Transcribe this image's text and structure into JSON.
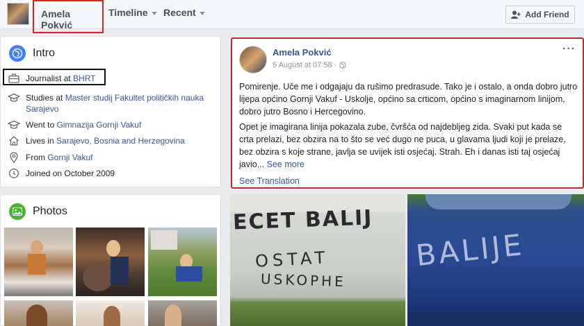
{
  "topbar": {
    "profile_name": "Amela Pokvić",
    "tabs": [
      "Timeline",
      "Recent"
    ],
    "add_friend_label": "Add Friend"
  },
  "intro": {
    "title": "Intro",
    "work_prefix": "Journalist at ",
    "work_org": "BHRT",
    "study_prefix": "Studies at ",
    "study_place": "Master studij Fakultet političkih nauka Sarajevo",
    "went_prefix": "Went to ",
    "went_place": "Gimnazija Gornji Vakuf",
    "lives_prefix": "Lives in ",
    "lives_place": "Sarajevo, Bosnia and Herzegovina",
    "from_prefix": "From ",
    "from_place": "Gornji Vakuf",
    "joined": "Joined on October 2009"
  },
  "photos": {
    "title": "Photos"
  },
  "post": {
    "author": "Amela Pokvić",
    "date": "5 August at 07:58 · ",
    "menu": "···",
    "paragraph1": "Pomirenje. Uče me i odgajaju da rušimo predrasude. Tako je i ostalo, a onda dobro jutro lijepa općino Gornji Vakuf - Uskolje, općino sa crticom, općino s imaginarnom linijom, dobro jutro Bosno i Hercegovino.",
    "paragraph2": "Opet je imagirana linija pokazala zube, čvršća od najdebljeg zida. Svaki put kada se crta prelazi, bez obzira na to što se već dugo ne puca, u glavama ljudi koji je prelaze, bez obzira s koje strane, javlja se uvijek isti osjećaj. Strah. Eh i danas isti taj osjećaj javio... ",
    "see_more": "See more",
    "see_translation": "See Translation"
  },
  "graffiti": {
    "wall_line1": "ECET BALIJ",
    "wall_line2": "OSTAT",
    "wall_line3": "USKOPHE",
    "car_text": "BALIJE"
  },
  "colors": {
    "link": "#365899",
    "highlight_red": "#c8242c",
    "page_bg": "#e9ebee"
  }
}
